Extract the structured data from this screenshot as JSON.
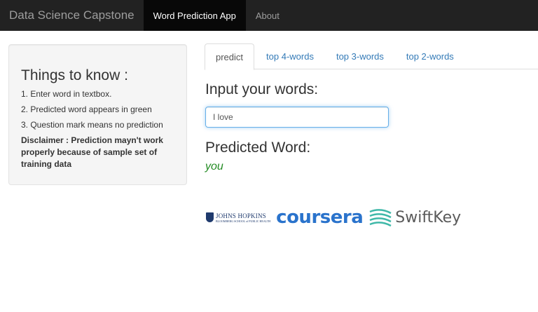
{
  "navbar": {
    "brand": "Data Science Capstone",
    "items": [
      {
        "label": "Word Prediction App",
        "active": true
      },
      {
        "label": "About",
        "active": false
      }
    ]
  },
  "sidebar": {
    "title": "Things to know :",
    "items": [
      "1. Enter word in textbox.",
      "2. Predicted word appears in green",
      "3. Question mark means no prediction"
    ],
    "disclaimer": "Disclaimer : Prediction mayn't work properly because of sample set of training data"
  },
  "tabs": [
    {
      "label": "predict",
      "active": true
    },
    {
      "label": "top 4-words",
      "active": false
    },
    {
      "label": "top 3-words",
      "active": false
    },
    {
      "label": "top 2-words",
      "active": false
    }
  ],
  "main": {
    "input_label": "Input your words:",
    "input_value": "I love ",
    "predicted_label": "Predicted Word:",
    "predicted_word": "you"
  },
  "logos": {
    "jhu_line1": "JOHNS HOPKINS",
    "jhu_line2": "BLOOMBERG SCHOOL of PUBLIC HEALTH",
    "coursera": "coursera",
    "swiftkey": "SwiftKey"
  },
  "colors": {
    "navbar_bg": "#222222",
    "active_nav_bg": "#080808",
    "link": "#337ab7",
    "prediction": "#228b22",
    "coursera": "#2a73cc"
  }
}
